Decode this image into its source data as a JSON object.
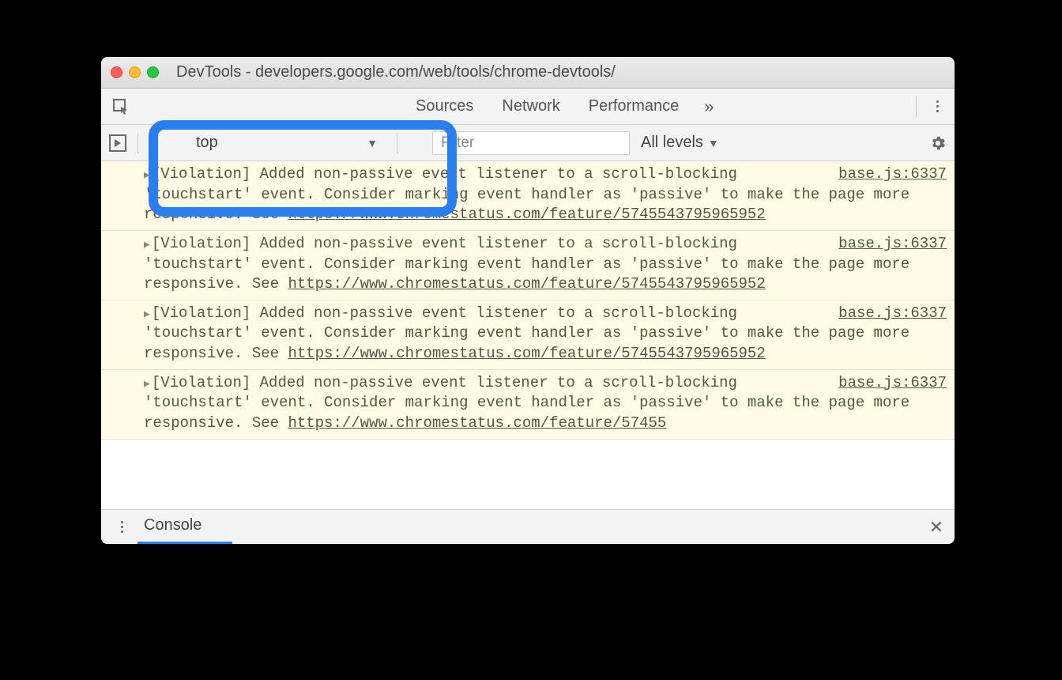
{
  "window": {
    "title": "DevTools - developers.google.com/web/tools/chrome-devtools/"
  },
  "tabs": {
    "sources": "Sources",
    "network": "Network",
    "performance": "Performance",
    "more": "»"
  },
  "subbar": {
    "context": "top",
    "filter_placeholder": "Filter",
    "levels": "All levels"
  },
  "messages": [
    {
      "source": "base.js:6337",
      "text": "[Violation] Added non-passive event listener to a scroll-blocking 'touchstart' event. Consider marking event handler as 'passive' to make the page more responsive. See ",
      "link": "https://www.chromestatus.com/feature/5745543795965952"
    },
    {
      "source": "base.js:6337",
      "text": "[Violation] Added non-passive event listener to a scroll-blocking 'touchstart' event. Consider marking event handler as 'passive' to make the page more responsive. See ",
      "link": "https://www.chromestatus.com/feature/5745543795965952"
    },
    {
      "source": "base.js:6337",
      "text": "[Violation] Added non-passive event listener to a scroll-blocking 'touchstart' event. Consider marking event handler as 'passive' to make the page more responsive. See ",
      "link": "https://www.chromestatus.com/feature/5745543795965952"
    },
    {
      "source": "base.js:6337",
      "text": "[Violation] Added non-passive event listener to a scroll-blocking 'touchstart' event. Consider marking event handler as 'passive' to make the page more responsive. See ",
      "link": "https://www.chromestatus.com/feature/57455"
    }
  ],
  "drawer": {
    "tab": "Console"
  }
}
